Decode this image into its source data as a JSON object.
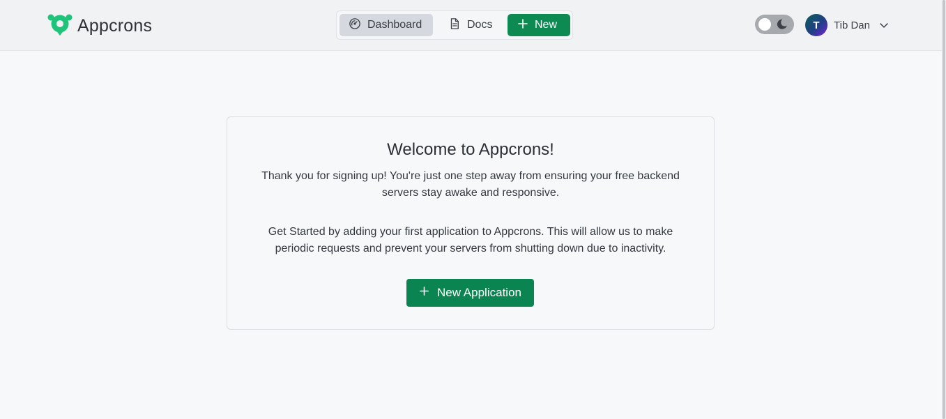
{
  "app": {
    "name": "Appcrons",
    "logo_icon": "location-pin-logo-icon",
    "accent_color": "#0c8a52"
  },
  "nav": {
    "dashboard_label": "Dashboard",
    "dashboard_icon": "speedometer-icon",
    "docs_label": "Docs",
    "docs_icon": "document-icon",
    "new_label": "New",
    "new_icon": "plus-icon",
    "active": "Dashboard"
  },
  "theme_toggle": {
    "state": "light",
    "icon": "moon-icon"
  },
  "user": {
    "avatar_initial": "T",
    "name": "Tib Dan",
    "menu_icon": "chevron-down-icon"
  },
  "welcome": {
    "title": "Welcome to Appcrons!",
    "intro": "Thank you for signing up! You're just one step away from ensuring your free backend servers stay awake and responsive.",
    "instructions": "Get Started by adding your first application to Appcrons. This will allow us to make periodic requests and prevent your servers from shutting down due to inactivity.",
    "button_label": "New Application",
    "button_icon": "plus-icon"
  }
}
